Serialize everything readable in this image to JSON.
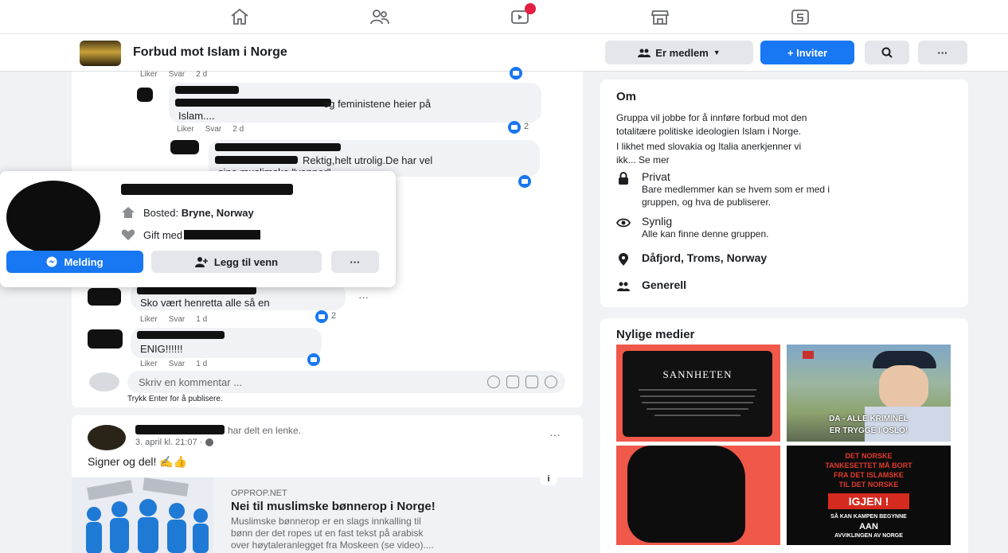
{
  "topnav": {
    "icons": [
      "home-icon",
      "friends-icon",
      "watch-icon",
      "marketplace-icon",
      "gaming-icon"
    ]
  },
  "group": {
    "name": "Forbud mot Islam i Norge",
    "member_label": "Er medlem",
    "invite_label": "+ Inviter",
    "more_label": "···"
  },
  "comments": {
    "c1_meta": {
      "like": "Liker",
      "reply": "Svar",
      "time": "2 d"
    },
    "c2": {
      "text_line1": "og feministene heier på",
      "text_line2": "Islam....",
      "meta_like": "Liker",
      "meta_reply": "Svar",
      "meta_time": "2 d",
      "reactions": "2"
    },
    "c3": {
      "text_line1": "Rektig,helt utrolig.De har vel",
      "text_line2": "sine muslimske \"venner\""
    },
    "c4": {
      "text": "Sko vært henretta alle så en",
      "meta_like": "Liker",
      "meta_reply": "Svar",
      "meta_time": "1 d",
      "reactions": "2",
      "more": "···"
    },
    "c5": {
      "text": "ENIG!!!!!!",
      "meta_like": "Liker",
      "meta_reply": "Svar",
      "meta_time": "1 d"
    },
    "input_placeholder": "Skriv en kommentar ...",
    "enter_hint": "Trykk Enter for å publisere."
  },
  "hovercard": {
    "location_prefix": "Bosted:",
    "location": "Bryne, Norway",
    "married_prefix": "Gift med",
    "message_label": "Melding",
    "add_friend_label": "Legg til venn",
    "more_label": "···"
  },
  "post": {
    "shared_text": "har delt en lenke.",
    "date": "3. april kl. 21:07 ·",
    "body": "Signer og del! ✍️👍",
    "more": "···",
    "link_domain": "OPPROP.NET",
    "link_title": "Nei til muslimske bønnerop i Norge!",
    "link_desc_1": "Muslimske bønnerop er en slags innkalling til",
    "link_desc_2": "bønn der det ropes ut en fast tekst på arabisk",
    "link_desc_3": "over høytaleranlegget fra Moskeen (se video)...."
  },
  "about": {
    "title": "Om",
    "desc_1": "Gruppa vil jobbe for å innføre forbud mot den",
    "desc_2": "totalitære politiske ideologien Islam i Norge.",
    "desc_3": "I likhet med slovakia og Italia anerkjenner vi",
    "desc_4": "ikk... Se mer",
    "private_head": "Privat",
    "private_sub_1": "Bare medlemmer kan se hvem som er med i",
    "private_sub_2": "gruppen, og hva de publiserer.",
    "visible_head": "Synlig",
    "visible_sub": "Alle kan finne denne gruppen.",
    "location": "Dåfjord, Troms, Norway",
    "category": "Generell"
  },
  "media": {
    "title": "Nylige medier",
    "tile1_heading": "SANNHETEN",
    "tile2_caption_1": "DA - ALLE KRIMINEL",
    "tile2_caption_2": "ER TRYGGE I OSLO!",
    "tile4_line1": "DET NORSKE",
    "tile4_line2": "TANKESETTET MÅ BORT",
    "tile4_line3": "FRA DET ISLAMSKE",
    "tile4_line4": "TIL DET NORSKE",
    "tile4_line5": "IGJEN !",
    "tile4_line6": "SÅ KAN KAMPEN BEGYNNE",
    "tile4_line7": "AAN",
    "tile4_line8": "AVVIKLINGEN AV NORGE"
  },
  "colors": {
    "accent": "#1877f2",
    "media_red": "#f0584a",
    "bg": "#f0f2f5"
  }
}
